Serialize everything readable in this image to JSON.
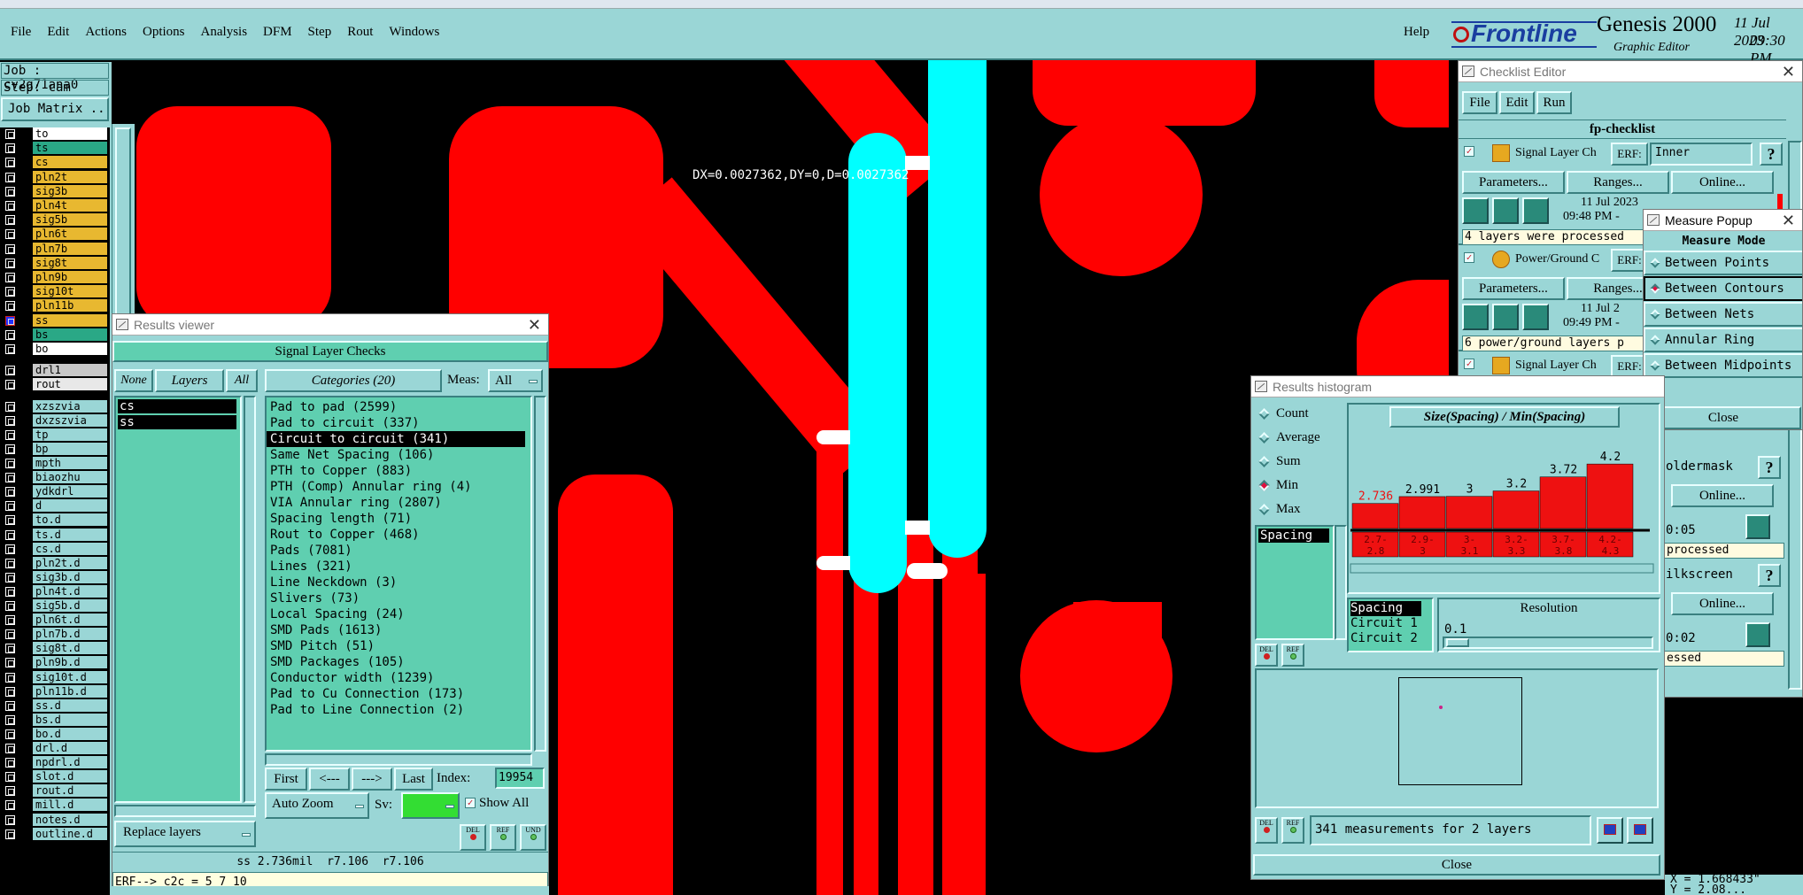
{
  "menu": {
    "items": [
      "File",
      "Edit",
      "Actions",
      "Options",
      "Analysis",
      "DFM",
      "Step",
      "Rout",
      "Windows"
    ],
    "help": "Help"
  },
  "brand": {
    "logo": "Frontline",
    "product": "Genesis 2000",
    "subtitle": "Graphic Editor",
    "date": "11 Jul 2023",
    "time": "09:30 PM"
  },
  "job": {
    "job_label": "Job : cv2g71ana0",
    "step_label": "Step: cam",
    "matrix_button": "Job Matrix ..."
  },
  "layers_top": [
    {
      "name": "to",
      "color": "#ffffff"
    },
    {
      "name": "ts",
      "color": "#2aa886"
    },
    {
      "name": "cs",
      "color": "#e8b830"
    },
    {
      "name": "pln2t",
      "color": "#e8b830"
    },
    {
      "name": "sig3b",
      "color": "#e8b830"
    },
    {
      "name": "pln4t",
      "color": "#e8b830"
    },
    {
      "name": "sig5b",
      "color": "#e8b830"
    },
    {
      "name": "pln6t",
      "color": "#e8b830"
    },
    {
      "name": "pln7b",
      "color": "#e8b830"
    },
    {
      "name": "sig8t",
      "color": "#e8b830"
    },
    {
      "name": "pln9b",
      "color": "#e8b830"
    },
    {
      "name": "sig10t",
      "color": "#e8b830"
    },
    {
      "name": "pln11b",
      "color": "#e8b830"
    },
    {
      "name": "ss",
      "color": "#e8b830"
    },
    {
      "name": "bs",
      "color": "#2aa886"
    },
    {
      "name": "bo",
      "color": "#ffffff"
    }
  ],
  "layers_drill": [
    {
      "name": "drl1",
      "color": "#c8c8c8"
    },
    {
      "name": "rout",
      "color": "#e8e8e8"
    }
  ],
  "layers_misc": [
    "xzszvia",
    "dxzszvia",
    "tp",
    "bp",
    "mpth",
    "biaozhu",
    "ydkdrl",
    "d",
    "to.d",
    "ts.d",
    "cs.d",
    "pln2t.d",
    "sig3b.d",
    "pln4t.d",
    "sig5b.d",
    "pln6t.d",
    "pln7b.d",
    "sig8t.d",
    "pln9b.d",
    "sig10t.d",
    "pln11b.d",
    "ss.d",
    "bs.d",
    "bo.d",
    "drl.d",
    "npdrl.d",
    "slot.d",
    "rout.d",
    "mill.d",
    "notes.d",
    "outline.d"
  ],
  "measure_readout": "DX=0.0027362,DY=0,D=0.0027362",
  "results_viewer": {
    "title": "Results viewer",
    "header": "Signal Layer Checks",
    "none_btn": "None",
    "layers_btn": "Layers",
    "all_btn": "All",
    "layer_list": [
      "cs",
      "ss"
    ],
    "categories_btn": "Categories (20)",
    "meas_label": "Meas:",
    "meas_value": "All",
    "categories": [
      "Pad to pad (2599)",
      "Pad to circuit (337)",
      "Circuit to circuit (341)",
      "Same Net Spacing (106)",
      "PTH to Copper (883)",
      "PTH (Comp) Annular ring (4)",
      "VIA Annular ring (2807)",
      "Spacing length (71)",
      "Rout to Copper (468)",
      "Pads (7081)",
      "Lines (321)",
      "Line Neckdown (3)",
      "Slivers (73)",
      "Local Spacing (24)",
      "SMD Pads (1613)",
      "SMD Pitch (51)",
      "SMD Packages (105)",
      "Conductor width (1239)",
      "Pad to Cu Connection (173)",
      "Pad to Line Connection (2)"
    ],
    "selected_category": 2,
    "first_btn": "First",
    "prev_btn": "<---",
    "next_btn": "--->",
    "last_btn": "Last",
    "index_label": "Index:",
    "index_value": "19954",
    "auto_zoom": "Auto Zoom",
    "sv_label": "Sv:",
    "show_all": "Show All",
    "replace_layers": "Replace layers",
    "del": "DEL",
    "ref": "REF",
    "und": "UND",
    "status_line": "ss 2.736mil  r7.106  r7.106",
    "command_line": "ERF--> c2c = 5 7 10"
  },
  "checklist": {
    "title": "Checklist Editor",
    "menu": [
      "File",
      "Edit",
      "Run"
    ],
    "name": "fp-checklist",
    "rows": [
      {
        "label": "Signal Layer Ch",
        "erf": "ERF:",
        "erf_value": "Inner",
        "date": "11 Jul 2023",
        "time": "09:48 PM -",
        "status": "4 layers were processed"
      },
      {
        "label": "Power/Ground C",
        "erf": "ERF:",
        "erf_value": "",
        "date": "11 Jul 2",
        "time": "09:49 PM -",
        "status": "6 power/ground layers p"
      },
      {
        "label": "Signal Layer Ch",
        "erf": "ERF:",
        "erf_value": ""
      }
    ],
    "parameters_btn": "Parameters...",
    "ranges_btn": "Ranges...",
    "online_btn": "Online...",
    "help": "?",
    "partial_1": "oldermask",
    "partial_time_1": "0:05",
    "partial_status_1": "processed",
    "partial_2": "ilkscreen",
    "partial_time_2": "0:02",
    "partial_status_2": "essed"
  },
  "measure_popup": {
    "title": "Measure Popup",
    "mode_label": "Measure Mode",
    "modes": [
      "Between Points",
      "Between Contours",
      "Between Nets",
      "Annular Ring",
      "Between Midpoints"
    ],
    "selected_mode": 1,
    "close": "Close"
  },
  "histogram": {
    "title": "Results histogram",
    "stats": [
      "Count",
      "Average",
      "Sum",
      "Min",
      "Max"
    ],
    "selected_stat": 3,
    "formula": "Size(Spacing) / Min(Spacing)",
    "measure_list": [
      "Spacing"
    ],
    "attr_list": [
      "Spacing",
      "Circuit 1",
      "Circuit 2"
    ],
    "resolution_label": "Resolution",
    "resolution_value": "0.1",
    "summary": "341 measurements for 2 layers",
    "close": "Close",
    "del": "DEL",
    "ref": "REF"
  },
  "chart_data": {
    "type": "bar",
    "categories": [
      "2.7-2.8",
      "2.9-3",
      "3-3.1",
      "3.2-3.3",
      "3.7-3.8",
      "4.2-4.3"
    ],
    "values": [
      2.736,
      2.991,
      3,
      3.2,
      3.72,
      4.2
    ],
    "value_labels": [
      "2.736",
      "2.991",
      "3",
      "3.2",
      "3.72",
      "4.2"
    ],
    "highlight_index": 0,
    "bar_color": "#ee1111",
    "label_color_highlight": "#ee1111",
    "title": "Size(Spacing) / Min(Spacing)",
    "xlabel": "",
    "ylabel": "",
    "ylim": [
      0,
      4.5
    ]
  },
  "coords": {
    "x": "X = 1.668433\"",
    "y": "Y = 2.08..."
  }
}
